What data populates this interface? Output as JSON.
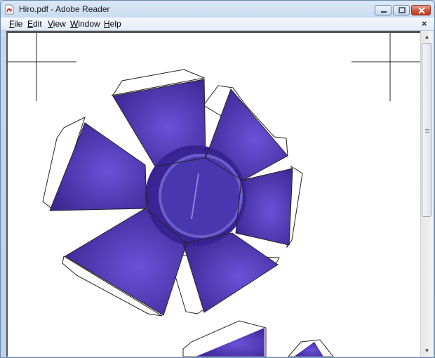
{
  "window": {
    "title": "Hiro.pdf - Adobe Reader",
    "app_icon": "pdf-file-icon",
    "controls": [
      "minimize-icon",
      "maximize-icon",
      "close-icon"
    ]
  },
  "menu": {
    "items": [
      {
        "accel": "F",
        "rest": "ile"
      },
      {
        "accel": "E",
        "rest": "dit"
      },
      {
        "accel": "V",
        "rest": "iew"
      },
      {
        "accel": "W",
        "rest": "indow"
      },
      {
        "accel": "H",
        "rest": "elp"
      }
    ],
    "close_glyph": "×"
  },
  "document": {
    "content": "papercraft template: purple pinwheel of triangular flaps with white glue tabs around a circular centre, crop marks in top corners",
    "fill_color": "#3a2590",
    "fill_light": "#6a52d8"
  },
  "colors": {
    "titlebar": "#c4d8ee",
    "accent_close": "#c0391f"
  }
}
